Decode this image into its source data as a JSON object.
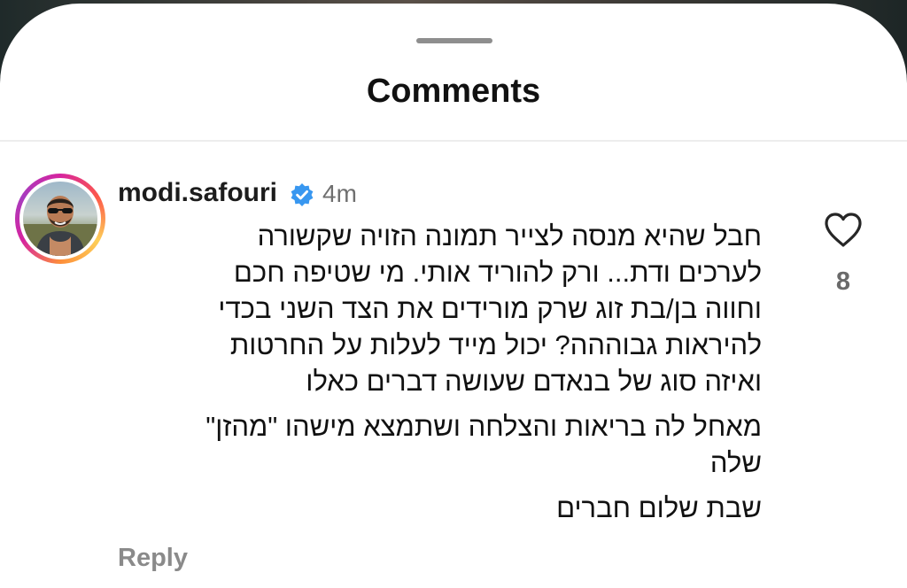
{
  "sheet": {
    "title": "Comments"
  },
  "comment": {
    "username": "modi.safouri",
    "verified_icon": "verified-badge-icon",
    "time": "4m",
    "paragraphs": [
      {
        "lines": [
          "חבל שהיא מנסה לצייר תמונה הזויה שקשורה",
          "לערכים ודת... ורק להוריד אותי. מי שטיפה חכם",
          "וחווה בן/בת זוג שרק מורידים את הצד השני בכדי",
          "להיראות גבוההה? יכול מייד לעלות על החרטות",
          "ואיזה סוג של בנאדם שעושה דברים כאלו"
        ]
      },
      {
        "lines": [
          "מאחל לה בריאות והצלחה ושתמצא מישהו \"מהזן\"",
          "שלה"
        ]
      },
      {
        "lines": [
          "שבת שלום חברים"
        ]
      }
    ],
    "reply_label": "Reply",
    "like_icon": "heart-outline-icon",
    "like_count": "8"
  },
  "colors": {
    "verified_blue": "#3897f0",
    "text_primary": "#111111",
    "text_secondary": "#6f6f6f"
  }
}
